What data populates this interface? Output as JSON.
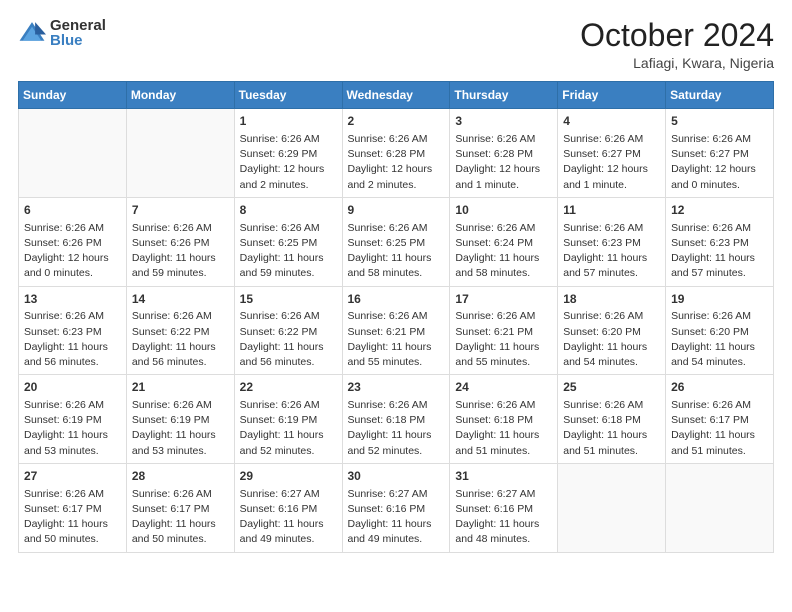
{
  "logo": {
    "general": "General",
    "blue": "Blue"
  },
  "header": {
    "month": "October 2024",
    "location": "Lafiagi, Kwara, Nigeria"
  },
  "weekdays": [
    "Sunday",
    "Monday",
    "Tuesday",
    "Wednesday",
    "Thursday",
    "Friday",
    "Saturday"
  ],
  "weeks": [
    [
      {
        "day": "",
        "info": ""
      },
      {
        "day": "",
        "info": ""
      },
      {
        "day": "1",
        "info": "Sunrise: 6:26 AM\nSunset: 6:29 PM\nDaylight: 12 hours and 2 minutes."
      },
      {
        "day": "2",
        "info": "Sunrise: 6:26 AM\nSunset: 6:28 PM\nDaylight: 12 hours and 2 minutes."
      },
      {
        "day": "3",
        "info": "Sunrise: 6:26 AM\nSunset: 6:28 PM\nDaylight: 12 hours and 1 minute."
      },
      {
        "day": "4",
        "info": "Sunrise: 6:26 AM\nSunset: 6:27 PM\nDaylight: 12 hours and 1 minute."
      },
      {
        "day": "5",
        "info": "Sunrise: 6:26 AM\nSunset: 6:27 PM\nDaylight: 12 hours and 0 minutes."
      }
    ],
    [
      {
        "day": "6",
        "info": "Sunrise: 6:26 AM\nSunset: 6:26 PM\nDaylight: 12 hours and 0 minutes."
      },
      {
        "day": "7",
        "info": "Sunrise: 6:26 AM\nSunset: 6:26 PM\nDaylight: 11 hours and 59 minutes."
      },
      {
        "day": "8",
        "info": "Sunrise: 6:26 AM\nSunset: 6:25 PM\nDaylight: 11 hours and 59 minutes."
      },
      {
        "day": "9",
        "info": "Sunrise: 6:26 AM\nSunset: 6:25 PM\nDaylight: 11 hours and 58 minutes."
      },
      {
        "day": "10",
        "info": "Sunrise: 6:26 AM\nSunset: 6:24 PM\nDaylight: 11 hours and 58 minutes."
      },
      {
        "day": "11",
        "info": "Sunrise: 6:26 AM\nSunset: 6:23 PM\nDaylight: 11 hours and 57 minutes."
      },
      {
        "day": "12",
        "info": "Sunrise: 6:26 AM\nSunset: 6:23 PM\nDaylight: 11 hours and 57 minutes."
      }
    ],
    [
      {
        "day": "13",
        "info": "Sunrise: 6:26 AM\nSunset: 6:23 PM\nDaylight: 11 hours and 56 minutes."
      },
      {
        "day": "14",
        "info": "Sunrise: 6:26 AM\nSunset: 6:22 PM\nDaylight: 11 hours and 56 minutes."
      },
      {
        "day": "15",
        "info": "Sunrise: 6:26 AM\nSunset: 6:22 PM\nDaylight: 11 hours and 56 minutes."
      },
      {
        "day": "16",
        "info": "Sunrise: 6:26 AM\nSunset: 6:21 PM\nDaylight: 11 hours and 55 minutes."
      },
      {
        "day": "17",
        "info": "Sunrise: 6:26 AM\nSunset: 6:21 PM\nDaylight: 11 hours and 55 minutes."
      },
      {
        "day": "18",
        "info": "Sunrise: 6:26 AM\nSunset: 6:20 PM\nDaylight: 11 hours and 54 minutes."
      },
      {
        "day": "19",
        "info": "Sunrise: 6:26 AM\nSunset: 6:20 PM\nDaylight: 11 hours and 54 minutes."
      }
    ],
    [
      {
        "day": "20",
        "info": "Sunrise: 6:26 AM\nSunset: 6:19 PM\nDaylight: 11 hours and 53 minutes."
      },
      {
        "day": "21",
        "info": "Sunrise: 6:26 AM\nSunset: 6:19 PM\nDaylight: 11 hours and 53 minutes."
      },
      {
        "day": "22",
        "info": "Sunrise: 6:26 AM\nSunset: 6:19 PM\nDaylight: 11 hours and 52 minutes."
      },
      {
        "day": "23",
        "info": "Sunrise: 6:26 AM\nSunset: 6:18 PM\nDaylight: 11 hours and 52 minutes."
      },
      {
        "day": "24",
        "info": "Sunrise: 6:26 AM\nSunset: 6:18 PM\nDaylight: 11 hours and 51 minutes."
      },
      {
        "day": "25",
        "info": "Sunrise: 6:26 AM\nSunset: 6:18 PM\nDaylight: 11 hours and 51 minutes."
      },
      {
        "day": "26",
        "info": "Sunrise: 6:26 AM\nSunset: 6:17 PM\nDaylight: 11 hours and 51 minutes."
      }
    ],
    [
      {
        "day": "27",
        "info": "Sunrise: 6:26 AM\nSunset: 6:17 PM\nDaylight: 11 hours and 50 minutes."
      },
      {
        "day": "28",
        "info": "Sunrise: 6:26 AM\nSunset: 6:17 PM\nDaylight: 11 hours and 50 minutes."
      },
      {
        "day": "29",
        "info": "Sunrise: 6:27 AM\nSunset: 6:16 PM\nDaylight: 11 hours and 49 minutes."
      },
      {
        "day": "30",
        "info": "Sunrise: 6:27 AM\nSunset: 6:16 PM\nDaylight: 11 hours and 49 minutes."
      },
      {
        "day": "31",
        "info": "Sunrise: 6:27 AM\nSunset: 6:16 PM\nDaylight: 11 hours and 48 minutes."
      },
      {
        "day": "",
        "info": ""
      },
      {
        "day": "",
        "info": ""
      }
    ]
  ]
}
